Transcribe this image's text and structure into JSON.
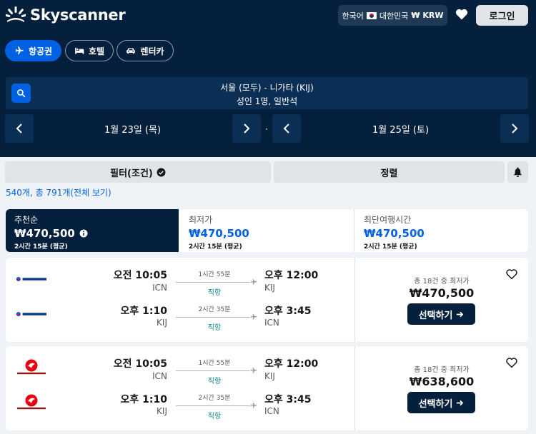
{
  "header": {
    "brand": "Skyscanner",
    "locale": {
      "language": "한국어",
      "country": "대한민국",
      "currency": "₩ KRW"
    },
    "login_label": "로그인"
  },
  "nav": {
    "flights": "항공권",
    "hotels": "호텔",
    "cars": "렌터카"
  },
  "search": {
    "route": "서울 (모두) - 니가타 (KIJ)",
    "passengers": "성인 1명, 일반석"
  },
  "dates": {
    "depart": "1월 23일 (목)",
    "separator": "·",
    "return": "1월 25일 (토)"
  },
  "toolbar": {
    "filter_label": "필터(조건)",
    "sort_label": "정렬"
  },
  "results_text": "540개, 총 791개(전체 보기)",
  "sort_tabs": [
    {
      "label": "추천순",
      "price": "₩470,500",
      "sub": "2시간 15분 (평균)"
    },
    {
      "label": "최저가",
      "price": "₩470,500",
      "sub": "2시간 15분 (평균)"
    },
    {
      "label": "최단여행시간",
      "price": "₩470,500",
      "sub": "2시간 15분 (평균)"
    }
  ],
  "cards": [
    {
      "airline": "KOREAN AIR",
      "legs": [
        {
          "dep_time": "오전 10:05",
          "dep_code": "ICN",
          "duration": "1시간 55분",
          "stops": "직항",
          "arr_time": "오후 12:00",
          "arr_code": "KIJ"
        },
        {
          "dep_time": "오후 1:10",
          "dep_code": "KIJ",
          "duration": "2시간 35분",
          "stops": "직항",
          "arr_time": "오후 3:45",
          "arr_code": "ICN"
        }
      ],
      "deal_count": "총 18건 중 최저가",
      "price": "₩470,500",
      "select_label": "선택하기"
    },
    {
      "airline": "JAPAN AIRLINES",
      "legs": [
        {
          "dep_time": "오전 10:05",
          "dep_code": "ICN",
          "duration": "1시간 55분",
          "stops": "직항",
          "arr_time": "오후 12:00",
          "arr_code": "KIJ"
        },
        {
          "dep_time": "오후 1:10",
          "dep_code": "KIJ",
          "duration": "2시간 35분",
          "stops": "직항",
          "arr_time": "오후 3:45",
          "arr_code": "ICN"
        }
      ],
      "deal_count": "총 18건 중 최저가",
      "price": "₩638,600",
      "select_label": "선택하기"
    }
  ],
  "colors": {
    "navy": "#05203c",
    "blue": "#0062e3",
    "teal": "#0c838a",
    "korean_air": "#0064de",
    "jal_red": "#e60012"
  }
}
